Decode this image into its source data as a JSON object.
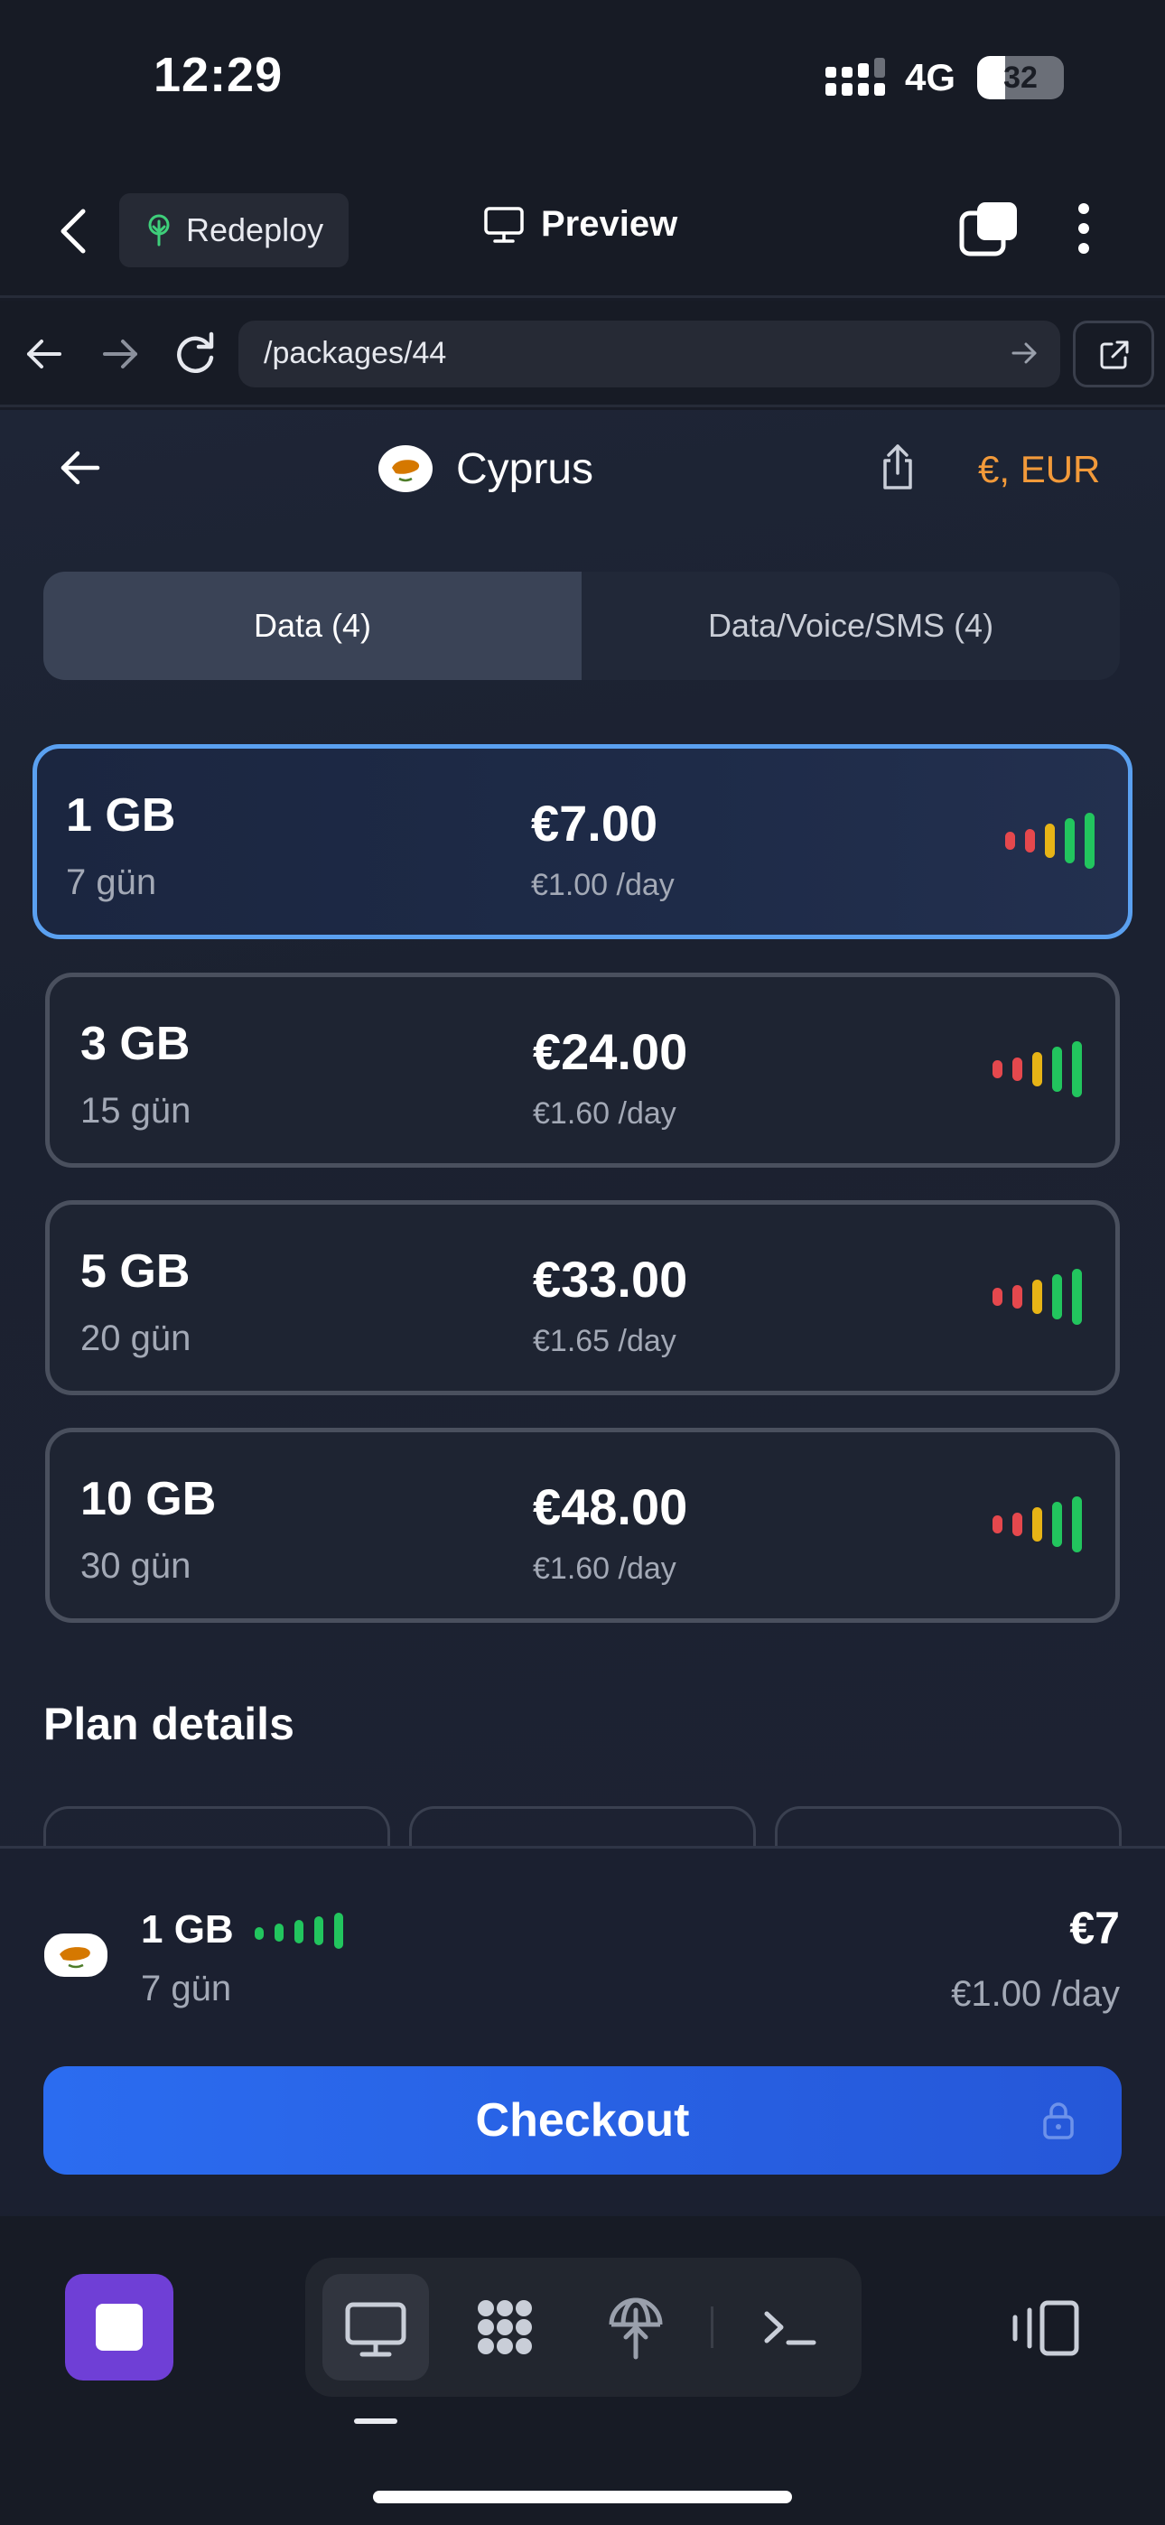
{
  "status_bar": {
    "time": "12:29",
    "network": "4G",
    "battery": "32",
    "battery_level_percent": 32
  },
  "app_header": {
    "redeploy_label": "Redeploy",
    "preview_label": "Preview"
  },
  "browser": {
    "url": "/packages/44"
  },
  "page": {
    "country": "Cyprus",
    "currency": "€, EUR",
    "tabs": [
      {
        "label": "Data (4)",
        "active": true
      },
      {
        "label": "Data/Voice/SMS (4)",
        "active": false
      }
    ],
    "packages": [
      {
        "data": "1 GB",
        "duration": "7 gün",
        "price": "€7.00",
        "per_day": "€1.00 /day",
        "selected": true,
        "signal_bars": 5
      },
      {
        "data": "3 GB",
        "duration": "15 gün",
        "price": "€24.00",
        "per_day": "€1.60 /day",
        "selected": false,
        "signal_bars": 5
      },
      {
        "data": "5 GB",
        "duration": "20 gün",
        "price": "€33.00",
        "per_day": "€1.65 /day",
        "selected": false,
        "signal_bars": 5
      },
      {
        "data": "10 GB",
        "duration": "30 gün",
        "price": "€48.00",
        "per_day": "€1.60 /day",
        "selected": false,
        "signal_bars": 5
      }
    ],
    "plan_details_heading": "Plan details"
  },
  "checkout": {
    "data": "1 GB",
    "duration": "7 gün",
    "price": "€7",
    "per_day": "€1.00 /day",
    "button_label": "Checkout"
  },
  "colors": {
    "accent": "#2b6cf0",
    "selected_border": "#5aa0f0",
    "currency": "#f29a3a",
    "signal_red": "#e5484d",
    "signal_yellow": "#e7b416",
    "signal_green": "#22c55e",
    "stop_button": "#6f3fd6"
  },
  "icons": {
    "header": [
      "chevron-left-icon",
      "sprout-icon",
      "monitor-icon",
      "tabs-icon",
      "more-vertical-icon"
    ],
    "browser": [
      "arrow-left-icon",
      "arrow-right-icon",
      "reload-icon",
      "arrow-go-icon",
      "external-link-icon"
    ],
    "page": [
      "arrow-left-icon",
      "cyprus-flag-icon",
      "share-icon",
      "signal-bars-icon",
      "lock-icon"
    ],
    "toolbar": [
      "stop-icon",
      "monitor-icon",
      "apps-icon",
      "deploy-icon",
      "terminal-icon",
      "mirror-device-icon"
    ]
  }
}
